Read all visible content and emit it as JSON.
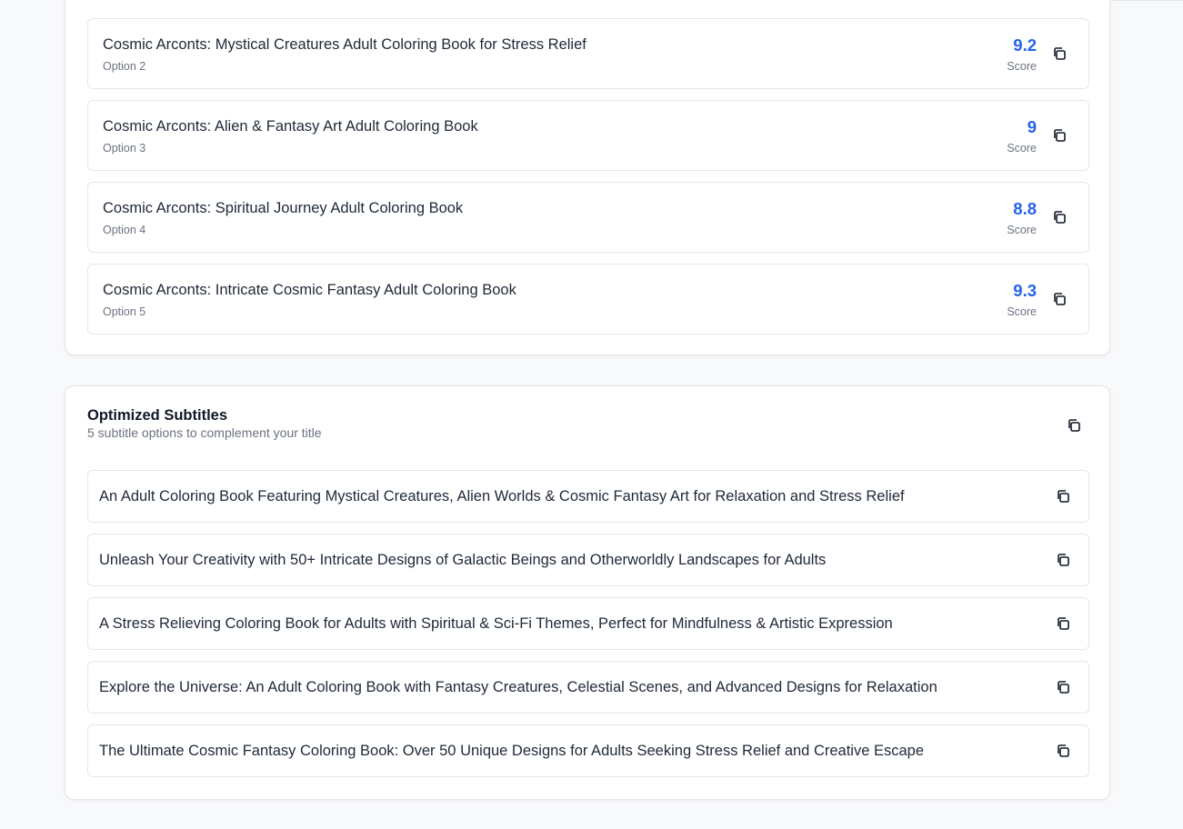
{
  "titles": {
    "items": [
      {
        "title": "Cosmic Arconts: Mystical Creatures Adult Coloring Book for Stress Relief",
        "option": "Option 2",
        "score": "9.2",
        "score_label": "Score"
      },
      {
        "title": "Cosmic Arconts: Alien & Fantasy Art Adult Coloring Book",
        "option": "Option 3",
        "score": "9",
        "score_label": "Score"
      },
      {
        "title": "Cosmic Arconts: Spiritual Journey Adult Coloring Book",
        "option": "Option 4",
        "score": "8.8",
        "score_label": "Score"
      },
      {
        "title": "Cosmic Arconts: Intricate Cosmic Fantasy Adult Coloring Book",
        "option": "Option 5",
        "score": "9.3",
        "score_label": "Score"
      }
    ]
  },
  "subtitles": {
    "heading": "Optimized Subtitles",
    "description": "5 subtitle options to complement your title",
    "items": [
      "An Adult Coloring Book Featuring Mystical Creatures, Alien Worlds & Cosmic Fantasy Art for Relaxation and Stress Relief",
      "Unleash Your Creativity with 50+ Intricate Designs of Galactic Beings and Otherworldly Landscapes for Adults",
      "A Stress Relieving Coloring Book for Adults with Spiritual & Sci-Fi Themes, Perfect for Mindfulness & Artistic Expression",
      "Explore the Universe: An Adult Coloring Book with Fantasy Creatures, Celestial Scenes, and Advanced Designs for Relaxation",
      "The Ultimate Cosmic Fantasy Coloring Book: Over 50 Unique Designs for Adults Seeking Stress Relief and Creative Escape"
    ]
  },
  "icons": {
    "copy": "copy-icon"
  },
  "colors": {
    "score": "#2563eb",
    "background": "#f8f9fb"
  }
}
